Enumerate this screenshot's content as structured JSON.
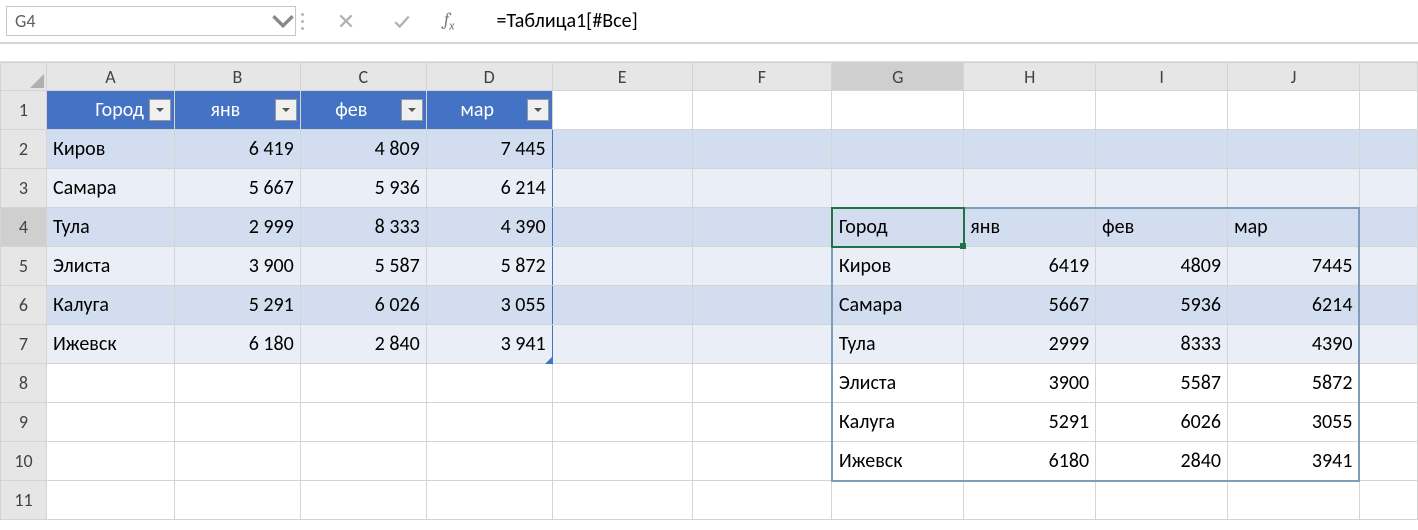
{
  "formula_bar": {
    "name_box": "G4",
    "formula": "=Таблица1[#Все]"
  },
  "columns": [
    "A",
    "B",
    "C",
    "D",
    "E",
    "F",
    "G",
    "H",
    "I",
    "J"
  ],
  "rows": [
    "1",
    "2",
    "3",
    "4",
    "5",
    "6",
    "7",
    "8",
    "9",
    "10",
    "11"
  ],
  "styled_table": {
    "headers": [
      "Город",
      "янв",
      "фев",
      "мар"
    ],
    "rows": [
      {
        "city": "Киров",
        "v": [
          "6 419",
          "4 809",
          "7 445"
        ]
      },
      {
        "city": "Самара",
        "v": [
          "5 667",
          "5 936",
          "6 214"
        ]
      },
      {
        "city": "Тула",
        "v": [
          "2 999",
          "8 333",
          "4 390"
        ]
      },
      {
        "city": "Элиста",
        "v": [
          "3 900",
          "5 587",
          "5 872"
        ]
      },
      {
        "city": "Калуга",
        "v": [
          "5 291",
          "6 026",
          "3 055"
        ]
      },
      {
        "city": "Ижевск",
        "v": [
          "6 180",
          "2 840",
          "3 941"
        ]
      }
    ]
  },
  "spill_table": {
    "headers": [
      "Город",
      "янв",
      "фев",
      "мар"
    ],
    "rows": [
      {
        "city": "Киров",
        "v": [
          "6419",
          "4809",
          "7445"
        ]
      },
      {
        "city": "Самара",
        "v": [
          "5667",
          "5936",
          "6214"
        ]
      },
      {
        "city": "Тула",
        "v": [
          "2999",
          "8333",
          "4390"
        ]
      },
      {
        "city": "Элиста",
        "v": [
          "3900",
          "5587",
          "5872"
        ]
      },
      {
        "city": "Калуга",
        "v": [
          "5291",
          "6026",
          "3055"
        ]
      },
      {
        "city": "Ижевск",
        "v": [
          "6180",
          "2840",
          "3941"
        ]
      }
    ]
  },
  "active_cell": "G4",
  "colors": {
    "table_header": "#4472c4",
    "band1": "#d2deef",
    "band2": "#eaeff7",
    "active_outline": "#217346"
  }
}
